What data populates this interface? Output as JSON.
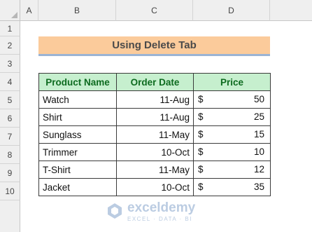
{
  "columns": [
    "A",
    "B",
    "C",
    "D"
  ],
  "rows": [
    "1",
    "2",
    "3",
    "4",
    "5",
    "6",
    "7",
    "8",
    "9",
    "10"
  ],
  "title": "Using Delete Tab",
  "table": {
    "headers": [
      "Product Name",
      "Order Date",
      "Price"
    ],
    "rows": [
      {
        "product": "Watch",
        "date": "11-Aug",
        "currency": "$",
        "price": "50"
      },
      {
        "product": "Shirt",
        "date": "11-Aug",
        "currency": "$",
        "price": "25"
      },
      {
        "product": "Sunglass",
        "date": "11-May",
        "currency": "$",
        "price": "15"
      },
      {
        "product": "Trimmer",
        "date": "10-Oct",
        "currency": "$",
        "price": "10"
      },
      {
        "product": "T-Shirt",
        "date": "11-May",
        "currency": "$",
        "price": "12"
      },
      {
        "product": "Jacket",
        "date": "10-Oct",
        "currency": "$",
        "price": "35"
      }
    ]
  },
  "watermark": {
    "name": "exceldemy",
    "tagline": "EXCEL · DATA · BI"
  },
  "colors": {
    "title_fill": "#fbcb9b",
    "title_underline": "#9bb4d4",
    "header_fill": "#c6efce",
    "header_text": "#0d6b1f"
  }
}
